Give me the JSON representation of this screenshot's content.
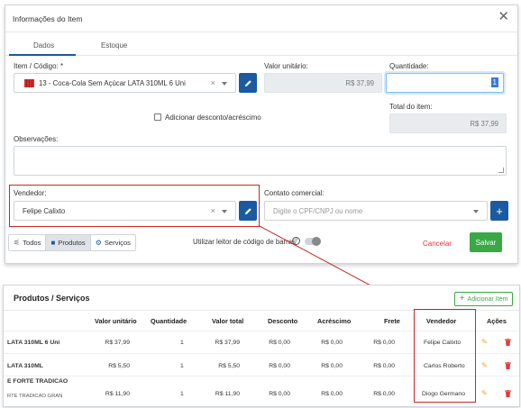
{
  "modal": {
    "title": "Informações do Item",
    "close_icon": "close-icon",
    "tabs": [
      {
        "label": "Dados",
        "active": true
      },
      {
        "label": "Estoque",
        "active": false
      }
    ],
    "item": {
      "label": "Item / Código: *",
      "value": "13 - Coca-Cola Sem Açúcar LATA 310ML 6 Uni"
    },
    "unit_price": {
      "label": "Valor unitário:",
      "value": "R$ 37,99"
    },
    "quantity": {
      "label": "Quantidade:",
      "value": "1"
    },
    "discount_label": "Adicionar desconto/acréscimo",
    "total": {
      "label": "Total do item:",
      "value": "R$ 37,99"
    },
    "observations_label": "Observações:",
    "seller": {
      "label": "Vendedor:",
      "value": "Felipe Calixto"
    },
    "contact": {
      "label": "Contato comercial:",
      "placeholder": "Digite o CPF/CNPJ ou nome"
    },
    "filters": [
      {
        "label": "Todos",
        "icon": "filter-icon",
        "active": false
      },
      {
        "label": "Produtos",
        "icon": "box-icon",
        "active": true
      },
      {
        "label": "Serviços",
        "icon": "services-icon",
        "active": false
      }
    ],
    "barcode_label": "Utilizar leitor de código de barras",
    "cancel_label": "Cancelar",
    "save_label": "Salvar"
  },
  "products": {
    "title": "Produtos / Serviços",
    "add_label": "Adicionar Item",
    "columns": [
      "Valor unitário",
      "Quantidade",
      "Valor total",
      "Desconto",
      "Acréscimo",
      "Frete",
      "Vendedor",
      "Ações"
    ],
    "rows": [
      {
        "name": "LATA 310ML 6 Uni",
        "sub": "",
        "unit": "R$ 37,99",
        "qty": "1",
        "total": "R$ 37,99",
        "discount": "R$ 0,00",
        "addition": "R$ 0,00",
        "freight": "R$ 0,00",
        "seller": "Felipe Calixto"
      },
      {
        "name": "LATA 310ML",
        "sub": "",
        "unit": "R$ 5,50",
        "qty": "1",
        "total": "R$ 5,50",
        "discount": "R$ 0,00",
        "addition": "R$ 0,00",
        "freight": "R$ 0,00",
        "seller": "Carlos Roberto"
      },
      {
        "name": "E FORTE TRADICAO",
        "sub": "RTE TRADICAO GRAN",
        "unit": "R$ 11,90",
        "qty": "1",
        "total": "R$ 11,90",
        "discount": "R$ 0,00",
        "addition": "R$ 0,00",
        "freight": "R$ 0,00",
        "seller": "Diogo Germano"
      }
    ]
  },
  "colors": {
    "primary": "#1a5aa0",
    "save": "#3aa845",
    "cancel": "#d9363e",
    "highlight": "#c62828",
    "edit": "#f0a020",
    "delete": "#e53935"
  }
}
